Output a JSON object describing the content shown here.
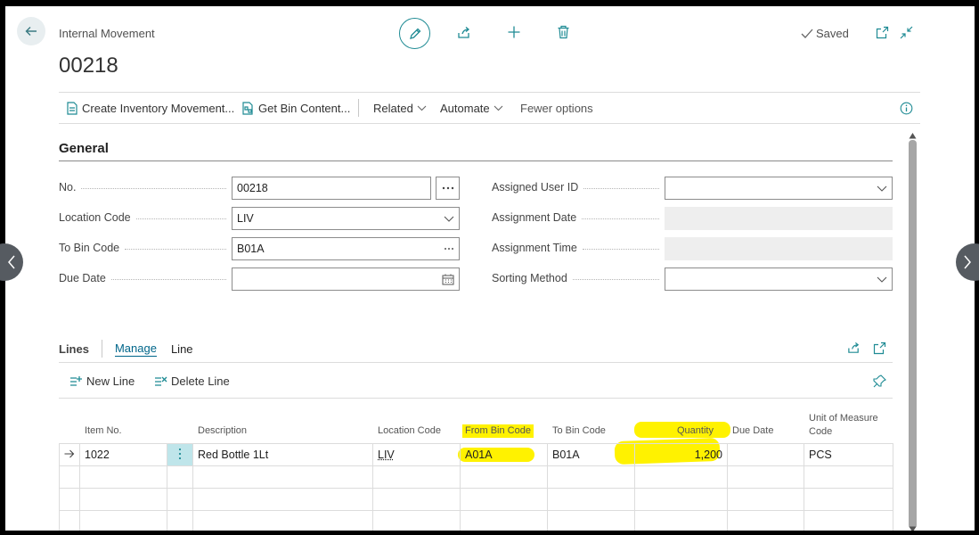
{
  "header": {
    "entity_type": "Internal Movement",
    "record_id": "00218",
    "saved_label": "Saved"
  },
  "actions": {
    "create_inventory_movement": "Create Inventory Movement...",
    "get_bin_content": "Get Bin Content...",
    "related": "Related",
    "automate": "Automate",
    "fewer_options": "Fewer options"
  },
  "general": {
    "title": "General",
    "no_label": "No.",
    "no_value": "00218",
    "location_code_label": "Location Code",
    "location_code_value": "LIV",
    "to_bin_code_label": "To Bin Code",
    "to_bin_code_value": "B01A",
    "due_date_label": "Due Date",
    "due_date_value": "",
    "assigned_user_id_label": "Assigned User ID",
    "assigned_user_id_value": "",
    "assignment_date_label": "Assignment Date",
    "assignment_time_label": "Assignment Time",
    "sorting_method_label": "Sorting Method",
    "sorting_method_value": ""
  },
  "lines": {
    "title": "Lines",
    "tab_manage": "Manage",
    "tab_line": "Line",
    "new_line": "New Line",
    "delete_line": "Delete Line",
    "columns": {
      "item_no": "Item No.",
      "description": "Description",
      "location_code": "Location Code",
      "from_bin_code": "From Bin Code",
      "to_bin_code": "To Bin Code",
      "quantity": "Quantity",
      "due_date": "Due Date",
      "uom_1": "Unit of Measure",
      "uom_2": "Code"
    },
    "rows": [
      {
        "item_no": "1022",
        "description": "Red Bottle 1Lt",
        "location_code": "LIV",
        "from_bin_code": "A01A",
        "to_bin_code": "B01A",
        "quantity": "1,200",
        "due_date": "",
        "uom": "PCS"
      }
    ]
  },
  "colors": {
    "accent": "#1f8b94",
    "highlight": "#fff200",
    "link": "#00668a"
  }
}
